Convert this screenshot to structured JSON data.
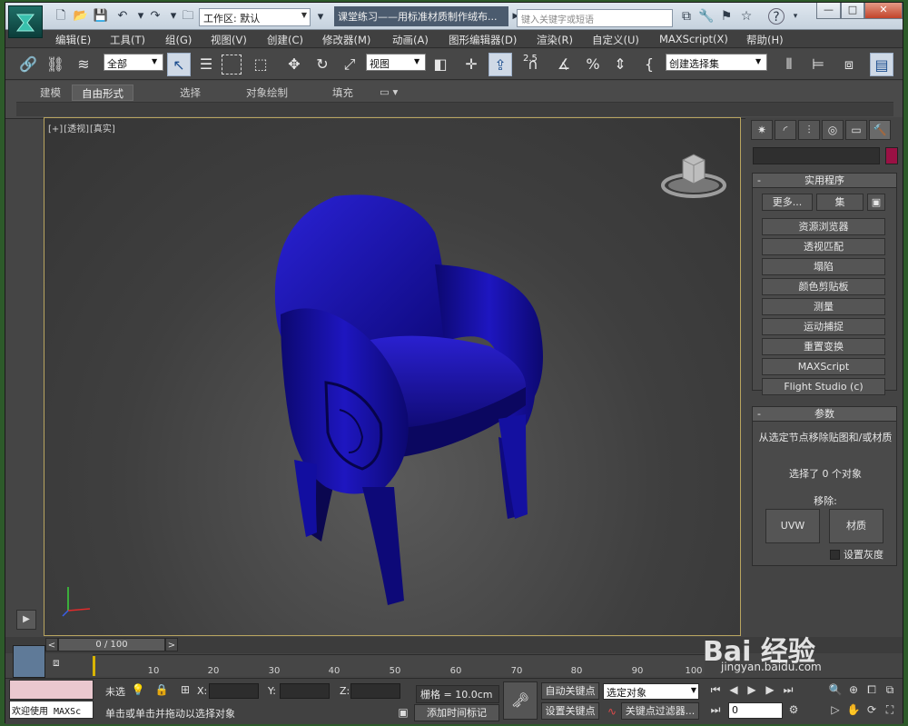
{
  "titlebar": {
    "workspace_label": "工作区: 默认",
    "title": "课堂练习——用标准材质制作绒布...",
    "search_placeholder": "键入关键字或短语",
    "min": "—",
    "max": "□",
    "close": "✕"
  },
  "menu": [
    {
      "label": "编辑(E)"
    },
    {
      "label": "工具(T)"
    },
    {
      "label": "组(G)"
    },
    {
      "label": "视图(V)"
    },
    {
      "label": "创建(C)"
    },
    {
      "label": "修改器(M)"
    },
    {
      "label": "动画(A)"
    },
    {
      "label": "图形编辑器(D)"
    },
    {
      "label": "渲染(R)"
    },
    {
      "label": "自定义(U)"
    },
    {
      "label": "MAXScript(X)"
    },
    {
      "label": "帮助(H)"
    }
  ],
  "maintoolbar": {
    "filter_value": "全部",
    "ref_coord_value": "视图",
    "snap_label": "2.5",
    "named_set_value": "创建选择集"
  },
  "ribbon": {
    "tabs": [
      {
        "label": "建模"
      },
      {
        "label": "自由形式"
      },
      {
        "label": "选择"
      },
      {
        "label": "对象绘制"
      },
      {
        "label": "填充"
      }
    ],
    "active_tab": "自由形式"
  },
  "viewport": {
    "label_plus": "[+]",
    "label_view": "[透视]",
    "label_shading": "[真实]",
    "object_color": "#1a12b0"
  },
  "command_panel": {
    "tabs": [
      "create-icon",
      "modify-icon",
      "hierarchy-icon",
      "motion-icon",
      "display-icon",
      "utilities-icon"
    ],
    "color_swatch": "#9a1144",
    "utilities": {
      "header": "实用程序",
      "more_label": "更多...",
      "sets_label": "集",
      "buttons": [
        {
          "label": "资源浏览器"
        },
        {
          "label": "透视匹配"
        },
        {
          "label": "塌陷"
        },
        {
          "label": "颜色剪贴板"
        },
        {
          "label": "测量"
        },
        {
          "label": "运动捕捉"
        },
        {
          "label": "重置变换"
        },
        {
          "label": "MAXScript"
        },
        {
          "label": "Flight Studio (c)"
        }
      ]
    },
    "params": {
      "header": "参数",
      "description": "从选定节点移除贴图和/或材质",
      "selected_count": "选择了 0 个对象",
      "remove_label": "移除:",
      "uvw_label": "UVW",
      "material_label": "材质",
      "gray_label": "设置灰度"
    }
  },
  "timeline": {
    "frame_display": "0 / 100",
    "prev": "<",
    "next": ">",
    "ticks": [
      {
        "value": "10"
      },
      {
        "value": "20"
      },
      {
        "value": "30"
      },
      {
        "value": "40"
      },
      {
        "value": "50"
      },
      {
        "value": "60"
      },
      {
        "value": "70"
      },
      {
        "value": "80"
      },
      {
        "value": "90"
      },
      {
        "value": "100"
      }
    ]
  },
  "status": {
    "maxscript_text": "欢迎使用 MAXSc",
    "selection_label": "未选",
    "prompt": "单击或单击并拖动以选择对象",
    "x_label": "X:",
    "y_label": "Y:",
    "z_label": "Z:",
    "grid": "栅格 = 10.0cm",
    "add_time_tag": "添加时间标记",
    "auto_key": "自动关键点",
    "set_key": "设置关键点",
    "selected_object": "选定对象",
    "key_filters": "关键点过滤器...",
    "frame_value": "0"
  },
  "watermark": {
    "logo": "Bai 经验",
    "url": "jingyan.baidu.com"
  }
}
